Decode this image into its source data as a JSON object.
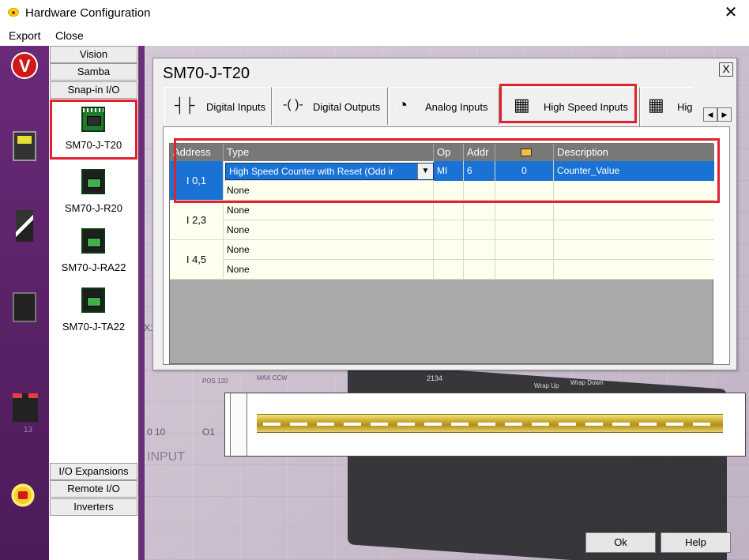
{
  "window": {
    "title": "Hardware Configuration",
    "close_glyph": "✕"
  },
  "menu": {
    "items": [
      "Export",
      "Close"
    ]
  },
  "categories": {
    "top": [
      "Vision",
      "Samba",
      "Snap-in I/O"
    ],
    "modules": [
      "SM70-J-T20",
      "SM70-J-R20",
      "SM70-J-RA22",
      "SM70-J-TA22"
    ],
    "bottom": [
      "I/O Expansions",
      "Remote I/O",
      "Inverters"
    ]
  },
  "strip": {
    "label": "13"
  },
  "background": {
    "texts": [
      "X1",
      "0 10",
      "O1",
      "INPUT",
      "POS 120",
      "MAX CCW",
      "2134",
      "Wrap Up",
      "Wrap Down"
    ]
  },
  "dialog": {
    "title": "SM70-J-T20",
    "close_glyph": "X",
    "tabs": [
      {
        "label": "Digital Inputs",
        "icon": "contact-icon",
        "glyph": "┤├"
      },
      {
        "label": "Digital Outputs",
        "icon": "coil-icon",
        "glyph": "-( )-"
      },
      {
        "label": "Analog Inputs",
        "icon": "gauge-icon",
        "glyph": "◔"
      },
      {
        "label": "High Speed Inputs",
        "icon": "high-speed-icon",
        "glyph": "▦"
      },
      {
        "label": "Hig",
        "icon": "high-speed-output-icon",
        "glyph": "▦"
      }
    ],
    "tab_scroll": {
      "left": "◀",
      "right": "▶"
    },
    "grid": {
      "columns": [
        "Address",
        "Type",
        "Op",
        "Addr",
        "",
        "Description"
      ],
      "rows": [
        {
          "address": "I 0,1",
          "type1": "High Speed Counter with Reset (Odd ir",
          "op": "MI",
          "addr": "6",
          "extra": "0",
          "description": "Counter_Value",
          "type2": "None"
        },
        {
          "address": "I 2,3",
          "type1": "None",
          "op": "",
          "addr": "",
          "extra": "",
          "description": "",
          "type2": "None"
        },
        {
          "address": "I 4,5",
          "type1": "None",
          "op": "",
          "addr": "",
          "extra": "",
          "description": "",
          "type2": "None"
        }
      ]
    }
  },
  "buttons": {
    "ok": "Ok",
    "help": "Help"
  },
  "colors": {
    "accent": "#1a73d4",
    "highlight": "#e0222f",
    "purple": "#5b2268"
  }
}
